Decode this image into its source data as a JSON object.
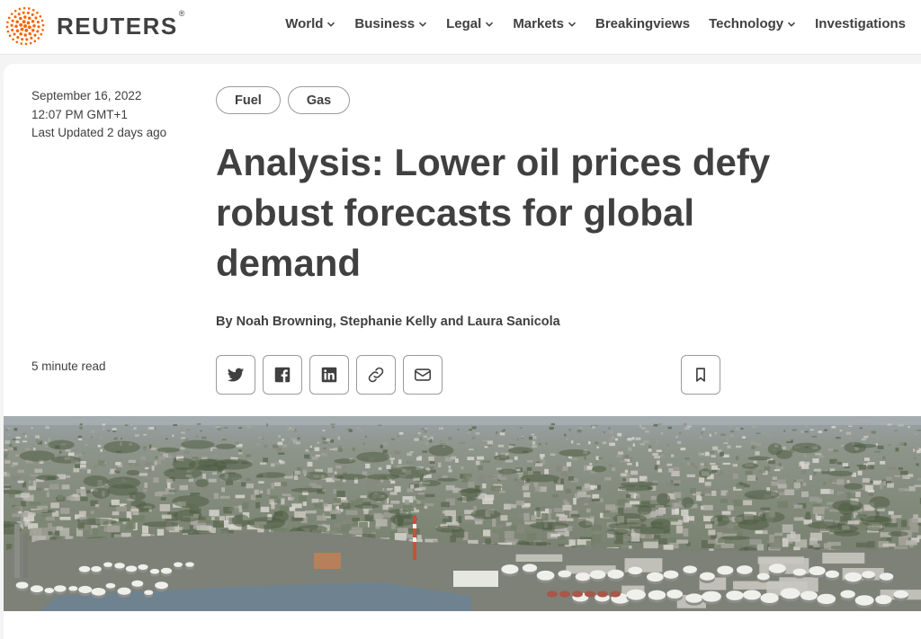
{
  "brand": {
    "name": "REUTERS",
    "registered": "®",
    "accent": "#fa6400"
  },
  "nav": {
    "items": [
      {
        "label": "World",
        "dropdown": true
      },
      {
        "label": "Business",
        "dropdown": true
      },
      {
        "label": "Legal",
        "dropdown": true
      },
      {
        "label": "Markets",
        "dropdown": true
      },
      {
        "label": "Breakingviews",
        "dropdown": false
      },
      {
        "label": "Technology",
        "dropdown": true
      },
      {
        "label": "Investigations",
        "dropdown": false
      }
    ]
  },
  "article": {
    "date": "September 16, 2022",
    "time": "12:07 PM GMT+1",
    "updated": "Last Updated 2 days ago",
    "read_time": "5 minute read",
    "tags": [
      "Fuel",
      "Gas"
    ],
    "headline": "Analysis: Lower oil prices defy robust forecasts for global demand",
    "byline": "By Noah Browning, Stephanie Kelly and Laura Sanicola"
  },
  "share": {
    "icons": [
      "twitter-icon",
      "facebook-icon",
      "linkedin-icon",
      "link-icon",
      "email-icon"
    ],
    "bookmark_icon": "bookmark-icon"
  },
  "hero": {
    "description_icon": "aerial-photo-industrial-port"
  }
}
